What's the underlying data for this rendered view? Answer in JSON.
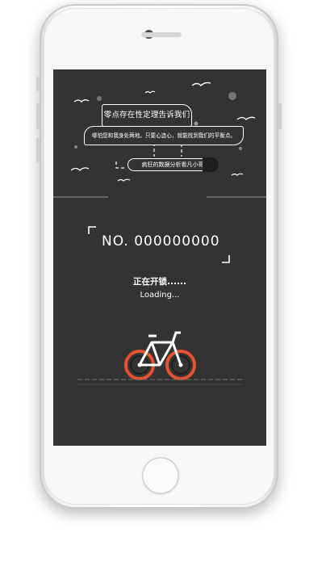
{
  "screen": {
    "bubble_top": "零点存在性定理告诉我们",
    "bubble_mid": "哪怕您和我身处两地。只要心连心，就能找到我们的平衡点。",
    "bubble_bottom": "疯狂的数据分析看凡小哥",
    "bike_number": "NO. 000000000",
    "status_unlocking": "正在开锁......",
    "status_loading": "Loading..."
  },
  "colors": {
    "screen_bg": "#333333",
    "accent": "#e8512f",
    "text": "#ffffff"
  },
  "icons": [
    "bird-icon",
    "bicycle-icon",
    "corner-bracket-icon"
  ]
}
